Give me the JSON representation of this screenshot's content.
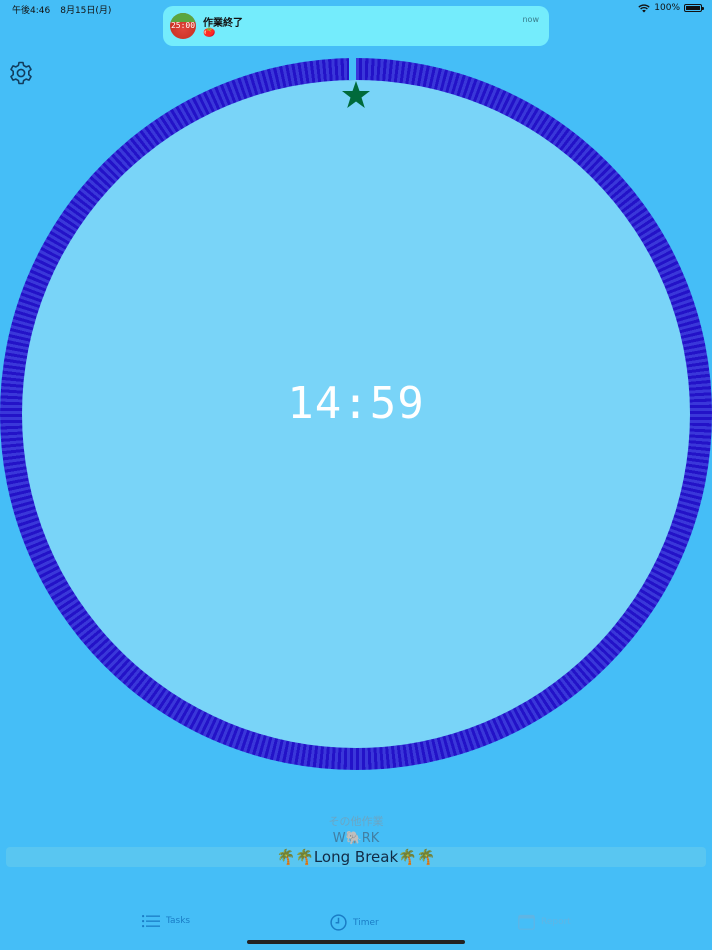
{
  "status_bar": {
    "time": "午後4:46",
    "date": "8月15日(月)",
    "battery": "100%",
    "battery_level": 1.0,
    "icons": [
      "wifi-icon",
      "battery-icon"
    ]
  },
  "notification": {
    "icon_text": "25:00",
    "title": "作業終了",
    "body": "🍅",
    "time": "now"
  },
  "settings": {
    "icon": "gear-icon"
  },
  "timer": {
    "display": "14:59",
    "marker_icon": "star-icon",
    "colors": {
      "ring": "#2312c8",
      "face": "#79d4f8",
      "marker": "#006a3b",
      "background": "#45bef7"
    }
  },
  "task_picker": {
    "items": [
      {
        "label": "その他作業"
      },
      {
        "label": "W🐘RK"
      },
      {
        "label": "🌴🌴Long Break🌴🌴"
      }
    ],
    "selected_index": 2
  },
  "tab_bar": {
    "tabs": [
      {
        "label": "Tasks",
        "icon": "list-icon"
      },
      {
        "label": "Timer",
        "icon": "clock-icon"
      },
      {
        "label": "Report",
        "icon": "calendar-icon"
      }
    ],
    "selected": "Timer"
  }
}
